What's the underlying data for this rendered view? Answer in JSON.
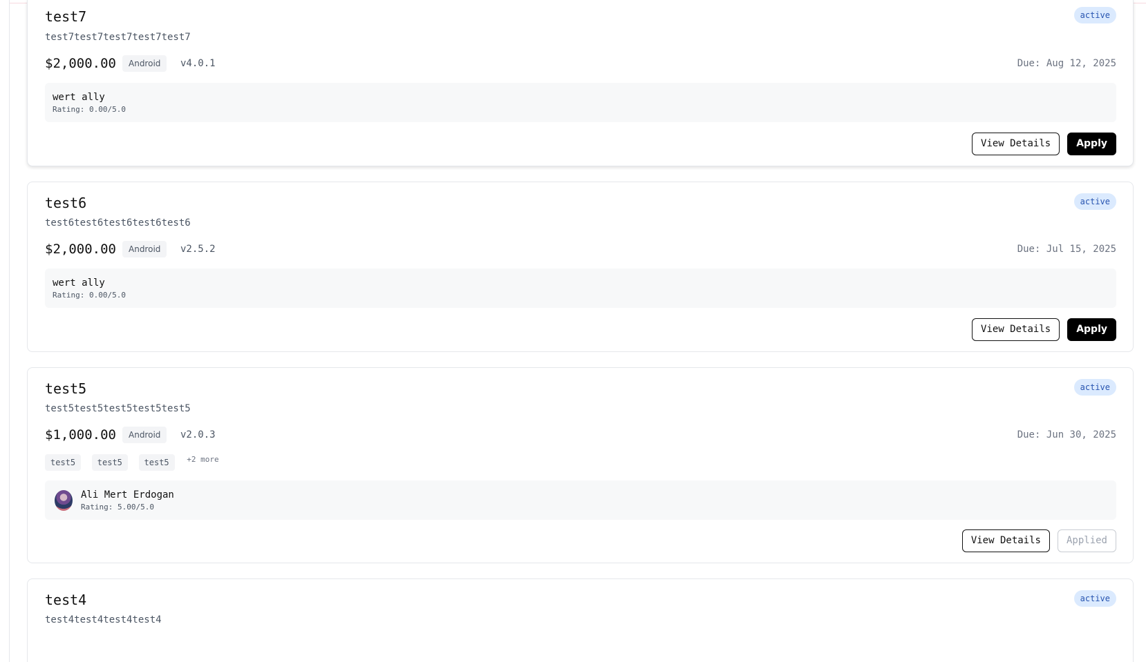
{
  "projects": [
    {
      "title": "test7",
      "description": "test7test7test7test7test7",
      "status": "active",
      "price": "$2,000.00",
      "platform": "Android",
      "version": "v4.0.1",
      "due": "Due: Aug 12, 2025",
      "owner": {
        "name": "wert ally",
        "rating": "Rating: 0.00/5.0"
      },
      "view_label": "View Details",
      "apply_label": "Apply"
    },
    {
      "title": "test6",
      "description": "test6test6test6test6test6",
      "status": "active",
      "price": "$2,000.00",
      "platform": "Android",
      "version": "v2.5.2",
      "due": "Due: Jul 15, 2025",
      "owner": {
        "name": "wert ally",
        "rating": "Rating: 0.00/5.0"
      },
      "view_label": "View Details",
      "apply_label": "Apply"
    },
    {
      "title": "test5",
      "description": "test5test5test5test5test5",
      "status": "active",
      "price": "$1,000.00",
      "platform": "Android",
      "version": "v2.0.3",
      "due": "Due: Jun 30, 2025",
      "tags": [
        "test5",
        "test5",
        "test5"
      ],
      "tags_more": "+2 more",
      "owner": {
        "name": "Ali Mert Erdogan",
        "rating": "Rating: 5.00/5.0"
      },
      "view_label": "View Details",
      "apply_label": "Applied"
    },
    {
      "title": "test4",
      "description": "test4test4test4test4",
      "status": "active"
    }
  ],
  "colors": {
    "badge_bg": "#dbeafe",
    "badge_text": "#2754b0",
    "primary_button": "#000000",
    "owner_panel": "#f7f8f9"
  }
}
